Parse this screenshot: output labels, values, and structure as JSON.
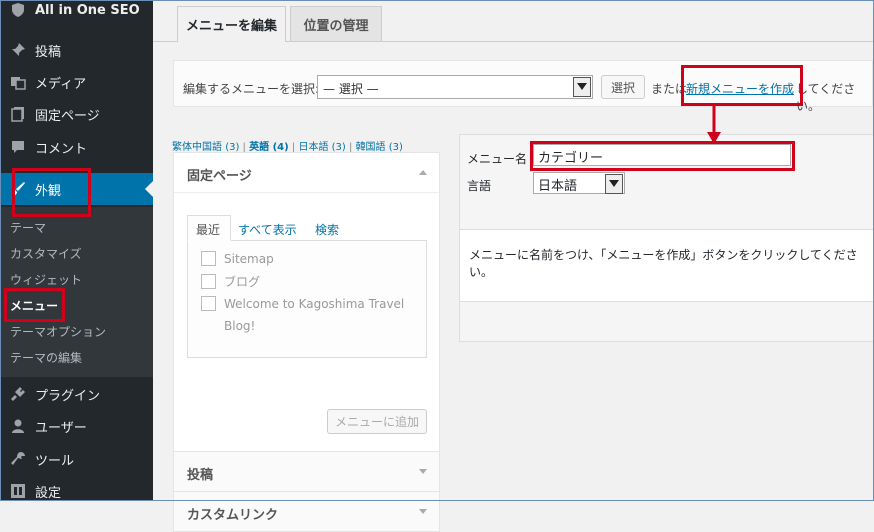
{
  "sidebar": {
    "top_item": "All in One SEO",
    "items": [
      {
        "label": "投稿",
        "icon": "pin-icon"
      },
      {
        "label": "メディア",
        "icon": "media-icon"
      },
      {
        "label": "固定ページ",
        "icon": "page-icon"
      },
      {
        "label": "コメント",
        "icon": "comment-icon"
      },
      {
        "label": "外観",
        "icon": "brush-icon"
      },
      {
        "label": "プラグイン",
        "icon": "plugin-icon"
      },
      {
        "label": "ユーザー",
        "icon": "user-icon"
      },
      {
        "label": "ツール",
        "icon": "wrench-icon"
      },
      {
        "label": "設定",
        "icon": "settings-icon"
      }
    ],
    "submenu": [
      "テーマ",
      "カスタマイズ",
      "ウィジェット",
      "メニュー",
      "テーマオプション",
      "テーマの編集"
    ]
  },
  "tabs": {
    "edit": "メニューを編集",
    "locations": "位置の管理"
  },
  "select_bar": {
    "label": "編集するメニューを選択:",
    "dropdown_value": "— 選択 —",
    "select_button": "選択",
    "or_text": "または",
    "create_link": "新規メニューを作成",
    "trailing_text": "してください。"
  },
  "languages": [
    {
      "label": "繁体中国語",
      "count": "(3)"
    },
    {
      "label": "英語",
      "count": "(4)"
    },
    {
      "label": "日本語",
      "count": "(3)"
    },
    {
      "label": "韓国語",
      "count": "(3)"
    }
  ],
  "accordion": {
    "pages_title": "固定ページ",
    "inner_tabs": {
      "recent": "最近",
      "all": "すべて表示",
      "search": "検索"
    },
    "pages": [
      "Sitemap",
      "ブログ",
      "Welcome to Kagoshima Travel Blog!"
    ],
    "add_button": "メニューに追加",
    "posts_title": "投稿",
    "custom_links_title": "カスタムリンク"
  },
  "menu_editor": {
    "name_label": "メニュー名",
    "name_value": "カテゴリー",
    "language_label": "言語",
    "language_value": "日本語",
    "instructions": "メニューに名前をつけ、「メニューを作成」ボタンをクリックしてください。"
  },
  "colors": {
    "highlight_red": "#d0021b",
    "wp_blue": "#0073aa",
    "sidebar_dark": "#23282d"
  }
}
